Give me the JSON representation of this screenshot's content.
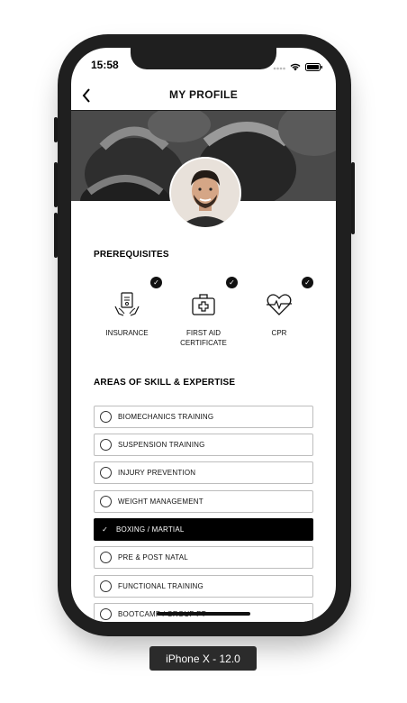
{
  "status_bar": {
    "time": "15:58"
  },
  "nav": {
    "title": "MY PROFILE"
  },
  "prerequisites": {
    "title": "PREREQUISITES",
    "items": [
      {
        "label": "INSURANCE",
        "icon": "insurance-document-icon",
        "checked": true
      },
      {
        "label": "FIRST AID\nCERTIFICATE",
        "icon": "first-aid-kit-icon",
        "checked": true
      },
      {
        "label": "CPR",
        "icon": "heartbeat-icon",
        "checked": true
      }
    ]
  },
  "skills": {
    "title": "AREAS OF SKILL & EXPERTISE",
    "items": [
      {
        "label": "BIOMECHANICS TRAINING",
        "selected": false
      },
      {
        "label": "SUSPENSION TRAINING",
        "selected": false
      },
      {
        "label": "INJURY PREVENTION",
        "selected": false
      },
      {
        "label": "WEIGHT MANAGEMENT",
        "selected": false
      },
      {
        "label": "BOXING / MARTIAL",
        "selected": true
      },
      {
        "label": "PRE & POST NATAL",
        "selected": false
      },
      {
        "label": "FUNCTIONAL TRAINING",
        "selected": false
      },
      {
        "label": "BOOTCAMP / GROUP PT",
        "selected": false
      }
    ]
  },
  "device_label": "iPhone X - 12.0",
  "colors": {
    "selected_bg": "#000000",
    "border": "#bdbdbd"
  }
}
